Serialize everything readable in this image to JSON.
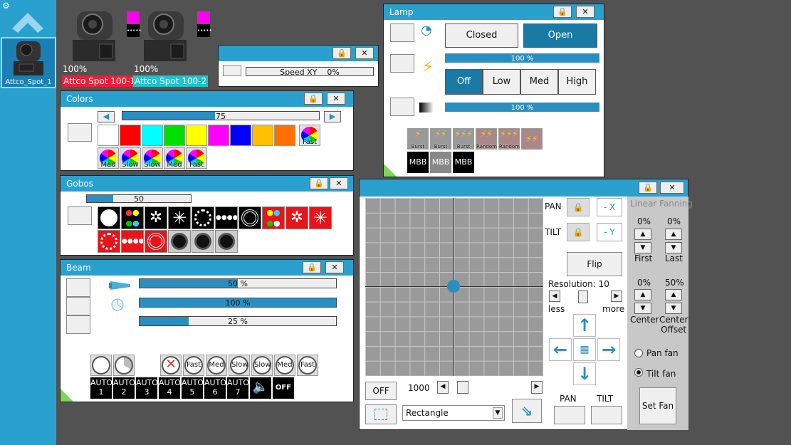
{
  "sidebar": {
    "gear_icon": "gear-icon",
    "up_icon": "up-chevron-icon",
    "fixture_label": "Attco_Spot_1"
  },
  "fixtures": [
    {
      "percent": "100%",
      "label": "Attco Spot 100-1",
      "color": "#e8213a"
    },
    {
      "percent": "100%",
      "label": "Attco Spot 100-2",
      "color": "#1fc3cf"
    }
  ],
  "speed": {
    "label": "Speed XY",
    "value": "0%"
  },
  "colors": {
    "title": "Colors",
    "slider_value": "75",
    "slider_fraction": 0.47,
    "swatches": [
      "#ffffff",
      "#ff0000",
      "#00ffff",
      "#00e000",
      "#ffff00",
      "#ff00ff",
      "#0000ff",
      "#ffc000",
      "#ff7000"
    ],
    "wheel_labels": [
      "Fast",
      "Med",
      "Slow",
      "Slow",
      "Med",
      "Fast"
    ]
  },
  "gobos": {
    "title": "Gobos",
    "slider_value": "50",
    "slider_fraction": 0.25
  },
  "beam": {
    "title": "Beam",
    "bars": [
      {
        "text": "50 %",
        "fraction": 0.5
      },
      {
        "text": "100 %",
        "fraction": 1.0
      },
      {
        "text": "25 %",
        "fraction": 0.25
      }
    ],
    "round_labels": [
      "Fast",
      "Med",
      "Slow",
      "Slow",
      "Med",
      "Fast"
    ],
    "auto_labels": [
      "AUTO\n1",
      "AUTO\n2",
      "AUTO\n3",
      "AUTO\n4",
      "AUTO\n5",
      "AUTO\n6",
      "AUTO\n7"
    ],
    "off_label": "OFF"
  },
  "lamp": {
    "title": "Lamp",
    "closed": "Closed",
    "open": "Open",
    "bar1": "100 %",
    "bar2": "100 %",
    "modes": [
      "Off",
      "Low",
      "Med",
      "High"
    ],
    "effects": [
      "Burst",
      "Burst",
      "Burst",
      "Random",
      "Random"
    ],
    "mbb": [
      "MBB",
      "MBB",
      "MBB"
    ]
  },
  "pantilt": {
    "pan": "PAN",
    "tilt": "TILT",
    "minus_x": "- X",
    "minus_y": "- Y",
    "flip": "Flip",
    "resolution": "Resolution: 10",
    "less": "less",
    "more": "more",
    "off": "OFF",
    "speed_value": "1000",
    "shape": "Rectangle",
    "pan_label": "PAN",
    "tilt_label": "TILT"
  },
  "fanning": {
    "title": "Linear Fanning",
    "first_value": "0%",
    "last_value": "0%",
    "first": "First",
    "last": "Last",
    "center_value": "0%",
    "offset_value": "50%",
    "center": "Center",
    "center_offset": "Center\nOffset",
    "pan_fan": "Pan fan",
    "tilt_fan": "Tilt fan",
    "set_fan": "Set Fan"
  }
}
